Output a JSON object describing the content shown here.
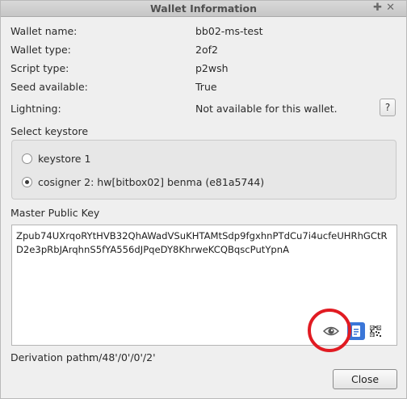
{
  "window": {
    "title": "Wallet Information"
  },
  "info": {
    "wallet_name_label": "Wallet name:",
    "wallet_name_value": "bb02-ms-test",
    "wallet_type_label": "Wallet type:",
    "wallet_type_value": "2of2",
    "script_type_label": "Script type:",
    "script_type_value": "p2wsh",
    "seed_label": "Seed available:",
    "seed_value": "True",
    "lightning_label": "Lightning:",
    "lightning_value": "Not available for this wallet.",
    "help_label": "?"
  },
  "keystore": {
    "title": "Select keystore",
    "options": [
      {
        "label": "keystore 1",
        "selected": false
      },
      {
        "label": "cosigner 2: hw[bitbox02] benma (e81a5744)",
        "selected": true
      }
    ]
  },
  "mpk": {
    "title": "Master Public Key",
    "value": "Zpub74UXrqoRYtHVB32QhAWadVSuKHTAMtSdp9fgxhnPTdCu7i4ucfeUHRhGCtRD2e3pRbJArqhnS5fYA556dJPqeDY8KhrweKCQBqscPutYpnA",
    "icons": [
      "eye-icon",
      "copy-icon",
      "qr-code-icon"
    ],
    "highlight_color": "#e11b22"
  },
  "derivation": {
    "label": "Derivation path:",
    "value": "m/48'/0'/0'/2'"
  },
  "buttons": {
    "close_label": "Close"
  }
}
